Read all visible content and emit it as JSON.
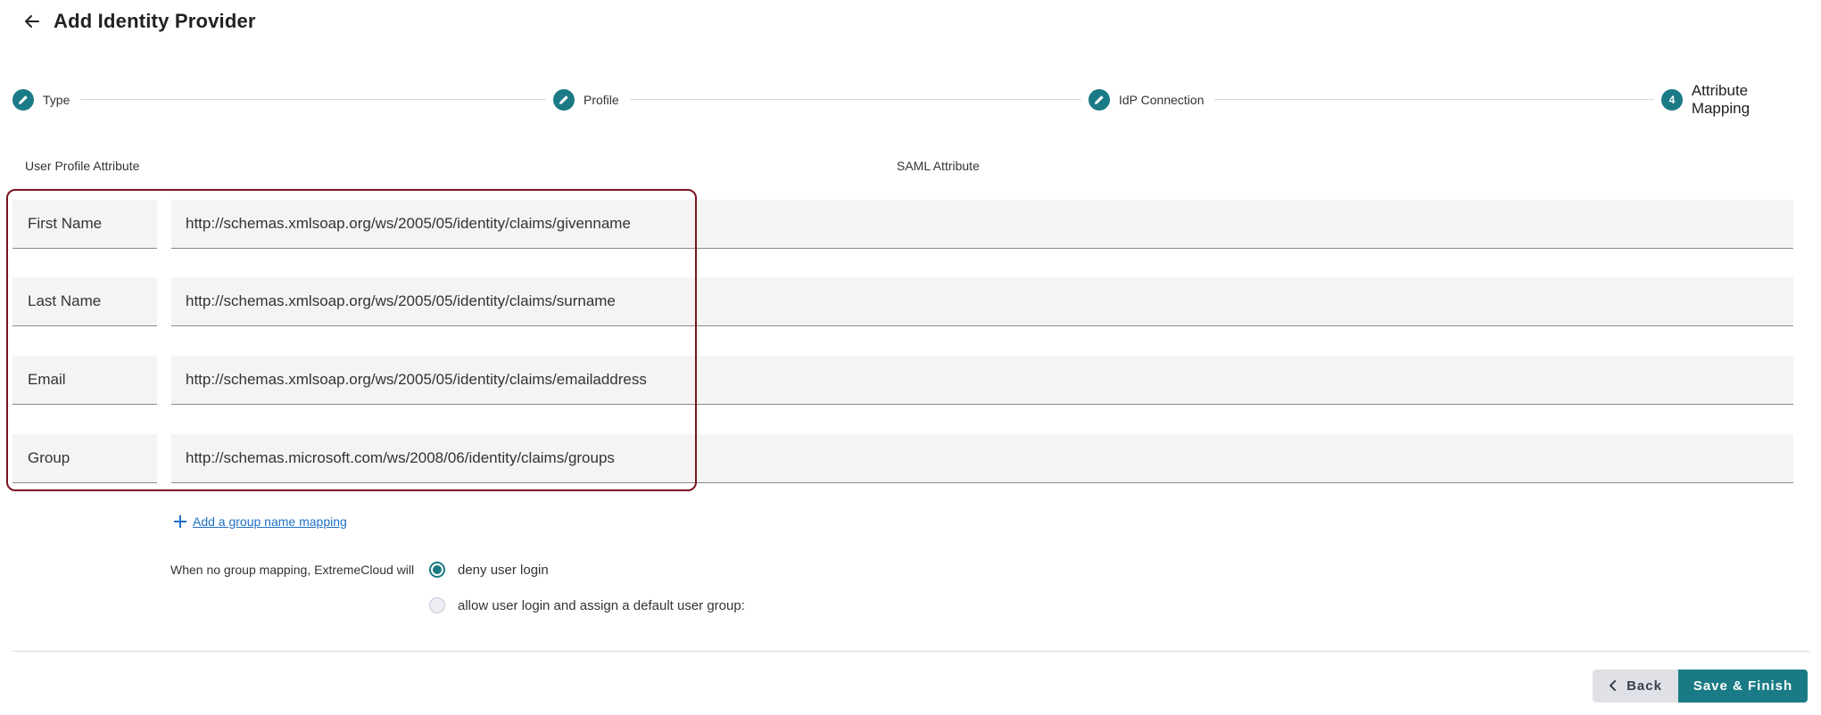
{
  "header": {
    "title": "Add Identity Provider"
  },
  "stepper": {
    "steps": [
      {
        "label": "Type",
        "state": "completed",
        "icon": "pencil-icon"
      },
      {
        "label": "Profile",
        "state": "completed",
        "icon": "pencil-icon"
      },
      {
        "label": "IdP Connection",
        "state": "completed",
        "icon": "pencil-icon"
      },
      {
        "label": "Attribute Mapping",
        "state": "active",
        "number": "4"
      }
    ]
  },
  "columns": {
    "user_profile": "User Profile Attribute",
    "saml": "SAML Attribute"
  },
  "mappings": [
    {
      "attribute": "First Name",
      "saml": "http://schemas.xmlsoap.org/ws/2005/05/identity/claims/givenname"
    },
    {
      "attribute": "Last Name",
      "saml": "http://schemas.xmlsoap.org/ws/2005/05/identity/claims/surname"
    },
    {
      "attribute": "Email",
      "saml": "http://schemas.xmlsoap.org/ws/2005/05/identity/claims/emailaddress"
    },
    {
      "attribute": "Group",
      "saml": "http://schemas.microsoft.com/ws/2008/06/identity/claims/groups"
    }
  ],
  "add_mapping": {
    "label": "Add a group name mapping"
  },
  "group_fallback": {
    "label": "When no group mapping, ExtremeCloud will",
    "options": [
      {
        "label": "deny user login",
        "checked": true
      },
      {
        "label": "allow user login and assign a default user group:",
        "checked": false
      }
    ]
  },
  "footer": {
    "back_label": "Back",
    "save_label": "Save & Finish"
  },
  "colors": {
    "accent": "#1a7b86",
    "highlight_border": "#7a1420",
    "link": "#1f6fc5"
  }
}
